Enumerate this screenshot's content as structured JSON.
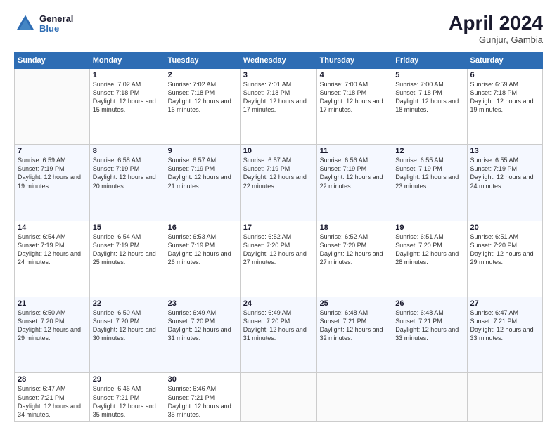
{
  "header": {
    "logo_line1": "General",
    "logo_line2": "Blue",
    "month": "April 2024",
    "location": "Gunjur, Gambia"
  },
  "days_of_week": [
    "Sunday",
    "Monday",
    "Tuesday",
    "Wednesday",
    "Thursday",
    "Friday",
    "Saturday"
  ],
  "weeks": [
    [
      {
        "num": "",
        "sunrise": "",
        "sunset": "",
        "daylight": ""
      },
      {
        "num": "1",
        "sunrise": "Sunrise: 7:02 AM",
        "sunset": "Sunset: 7:18 PM",
        "daylight": "Daylight: 12 hours and 15 minutes."
      },
      {
        "num": "2",
        "sunrise": "Sunrise: 7:02 AM",
        "sunset": "Sunset: 7:18 PM",
        "daylight": "Daylight: 12 hours and 16 minutes."
      },
      {
        "num": "3",
        "sunrise": "Sunrise: 7:01 AM",
        "sunset": "Sunset: 7:18 PM",
        "daylight": "Daylight: 12 hours and 17 minutes."
      },
      {
        "num": "4",
        "sunrise": "Sunrise: 7:00 AM",
        "sunset": "Sunset: 7:18 PM",
        "daylight": "Daylight: 12 hours and 17 minutes."
      },
      {
        "num": "5",
        "sunrise": "Sunrise: 7:00 AM",
        "sunset": "Sunset: 7:18 PM",
        "daylight": "Daylight: 12 hours and 18 minutes."
      },
      {
        "num": "6",
        "sunrise": "Sunrise: 6:59 AM",
        "sunset": "Sunset: 7:18 PM",
        "daylight": "Daylight: 12 hours and 19 minutes."
      }
    ],
    [
      {
        "num": "7",
        "sunrise": "Sunrise: 6:59 AM",
        "sunset": "Sunset: 7:19 PM",
        "daylight": "Daylight: 12 hours and 19 minutes."
      },
      {
        "num": "8",
        "sunrise": "Sunrise: 6:58 AM",
        "sunset": "Sunset: 7:19 PM",
        "daylight": "Daylight: 12 hours and 20 minutes."
      },
      {
        "num": "9",
        "sunrise": "Sunrise: 6:57 AM",
        "sunset": "Sunset: 7:19 PM",
        "daylight": "Daylight: 12 hours and 21 minutes."
      },
      {
        "num": "10",
        "sunrise": "Sunrise: 6:57 AM",
        "sunset": "Sunset: 7:19 PM",
        "daylight": "Daylight: 12 hours and 22 minutes."
      },
      {
        "num": "11",
        "sunrise": "Sunrise: 6:56 AM",
        "sunset": "Sunset: 7:19 PM",
        "daylight": "Daylight: 12 hours and 22 minutes."
      },
      {
        "num": "12",
        "sunrise": "Sunrise: 6:55 AM",
        "sunset": "Sunset: 7:19 PM",
        "daylight": "Daylight: 12 hours and 23 minutes."
      },
      {
        "num": "13",
        "sunrise": "Sunrise: 6:55 AM",
        "sunset": "Sunset: 7:19 PM",
        "daylight": "Daylight: 12 hours and 24 minutes."
      }
    ],
    [
      {
        "num": "14",
        "sunrise": "Sunrise: 6:54 AM",
        "sunset": "Sunset: 7:19 PM",
        "daylight": "Daylight: 12 hours and 24 minutes."
      },
      {
        "num": "15",
        "sunrise": "Sunrise: 6:54 AM",
        "sunset": "Sunset: 7:19 PM",
        "daylight": "Daylight: 12 hours and 25 minutes."
      },
      {
        "num": "16",
        "sunrise": "Sunrise: 6:53 AM",
        "sunset": "Sunset: 7:19 PM",
        "daylight": "Daylight: 12 hours and 26 minutes."
      },
      {
        "num": "17",
        "sunrise": "Sunrise: 6:52 AM",
        "sunset": "Sunset: 7:20 PM",
        "daylight": "Daylight: 12 hours and 27 minutes."
      },
      {
        "num": "18",
        "sunrise": "Sunrise: 6:52 AM",
        "sunset": "Sunset: 7:20 PM",
        "daylight": "Daylight: 12 hours and 27 minutes."
      },
      {
        "num": "19",
        "sunrise": "Sunrise: 6:51 AM",
        "sunset": "Sunset: 7:20 PM",
        "daylight": "Daylight: 12 hours and 28 minutes."
      },
      {
        "num": "20",
        "sunrise": "Sunrise: 6:51 AM",
        "sunset": "Sunset: 7:20 PM",
        "daylight": "Daylight: 12 hours and 29 minutes."
      }
    ],
    [
      {
        "num": "21",
        "sunrise": "Sunrise: 6:50 AM",
        "sunset": "Sunset: 7:20 PM",
        "daylight": "Daylight: 12 hours and 29 minutes."
      },
      {
        "num": "22",
        "sunrise": "Sunrise: 6:50 AM",
        "sunset": "Sunset: 7:20 PM",
        "daylight": "Daylight: 12 hours and 30 minutes."
      },
      {
        "num": "23",
        "sunrise": "Sunrise: 6:49 AM",
        "sunset": "Sunset: 7:20 PM",
        "daylight": "Daylight: 12 hours and 31 minutes."
      },
      {
        "num": "24",
        "sunrise": "Sunrise: 6:49 AM",
        "sunset": "Sunset: 7:20 PM",
        "daylight": "Daylight: 12 hours and 31 minutes."
      },
      {
        "num": "25",
        "sunrise": "Sunrise: 6:48 AM",
        "sunset": "Sunset: 7:21 PM",
        "daylight": "Daylight: 12 hours and 32 minutes."
      },
      {
        "num": "26",
        "sunrise": "Sunrise: 6:48 AM",
        "sunset": "Sunset: 7:21 PM",
        "daylight": "Daylight: 12 hours and 33 minutes."
      },
      {
        "num": "27",
        "sunrise": "Sunrise: 6:47 AM",
        "sunset": "Sunset: 7:21 PM",
        "daylight": "Daylight: 12 hours and 33 minutes."
      }
    ],
    [
      {
        "num": "28",
        "sunrise": "Sunrise: 6:47 AM",
        "sunset": "Sunset: 7:21 PM",
        "daylight": "Daylight: 12 hours and 34 minutes."
      },
      {
        "num": "29",
        "sunrise": "Sunrise: 6:46 AM",
        "sunset": "Sunset: 7:21 PM",
        "daylight": "Daylight: 12 hours and 35 minutes."
      },
      {
        "num": "30",
        "sunrise": "Sunrise: 6:46 AM",
        "sunset": "Sunset: 7:21 PM",
        "daylight": "Daylight: 12 hours and 35 minutes."
      },
      {
        "num": "",
        "sunrise": "",
        "sunset": "",
        "daylight": ""
      },
      {
        "num": "",
        "sunrise": "",
        "sunset": "",
        "daylight": ""
      },
      {
        "num": "",
        "sunrise": "",
        "sunset": "",
        "daylight": ""
      },
      {
        "num": "",
        "sunrise": "",
        "sunset": "",
        "daylight": ""
      }
    ]
  ]
}
